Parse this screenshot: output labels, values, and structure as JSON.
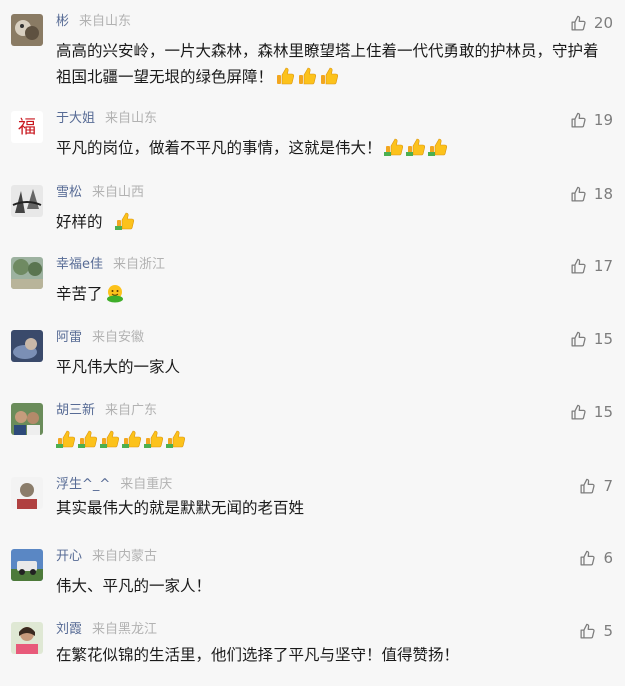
{
  "comments": [
    {
      "author": "彬",
      "location": "来自山东",
      "likes": "20",
      "text": "高高的兴安岭，一片大森林，森林里瞭望塔上住着一代代勇敢的护林员，守护着祖国北疆一望无垠的绿色屏障！",
      "emoji": [
        "thumbs-up-icon",
        "thumbs-up-icon",
        "thumbs-up-icon"
      ]
    },
    {
      "author": "于大姐",
      "location": "来自山东",
      "likes": "19",
      "text": "平凡的岗位，做着不平凡的事情，这就是伟大！",
      "emoji": [
        "thumbs-up-icon",
        "thumbs-up-icon",
        "thumbs-up-icon"
      ]
    },
    {
      "author": "雪松",
      "location": "来自山西",
      "likes": "18",
      "text": "好样的",
      "emoji": [
        "thumbs-up-icon"
      ]
    },
    {
      "author": "幸福e佳",
      "location": "来自浙江",
      "likes": "17",
      "text": "辛苦了",
      "emoji": [
        "hug-icon"
      ]
    },
    {
      "author": "阿雷",
      "location": "来自安徽",
      "likes": "15",
      "text": "平凡伟大的一家人",
      "emoji": []
    },
    {
      "author": "胡三新",
      "location": "来自广东",
      "likes": "15",
      "text": "",
      "emoji": [
        "thumbs-up-icon",
        "thumbs-up-icon",
        "thumbs-up-icon",
        "thumbs-up-icon",
        "thumbs-up-icon",
        "thumbs-up-icon"
      ]
    },
    {
      "author": "浮生^_^",
      "location": "来自重庆",
      "likes": "7",
      "text": "其实最伟大的就是默默无闻的老百姓",
      "emoji": []
    },
    {
      "author": "开心",
      "location": "来自内蒙古",
      "likes": "6",
      "text": "伟大、平凡的一家人！",
      "emoji": []
    },
    {
      "author": "刘霞",
      "location": "来自黑龙江",
      "likes": "5",
      "text": "在繁花似锦的生活里，他们选择了平凡与坚守！值得赞扬！",
      "emoji": []
    }
  ],
  "icons": {
    "like": "thumbs-up-outline-icon"
  },
  "colors": {
    "author": "#576b95",
    "location": "#b2b2b2",
    "likes": "#7d7d7d",
    "text": "#1a1a1a",
    "background": "#f7f7f7"
  }
}
